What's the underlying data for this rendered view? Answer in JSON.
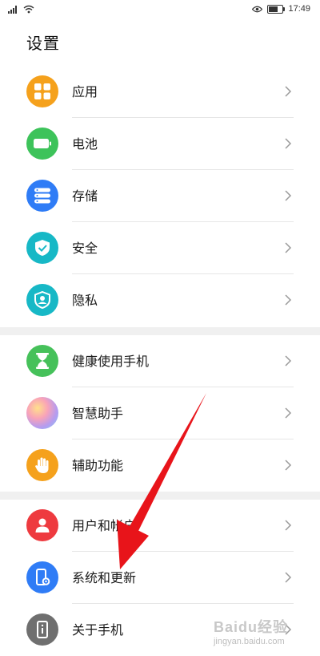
{
  "status_bar": {
    "time": "17:49"
  },
  "header": {
    "title": "设置"
  },
  "groups": [
    {
      "items": [
        {
          "label": "应用",
          "icon": "apps-grid-icon",
          "color": "#F5A11C"
        },
        {
          "label": "电池",
          "icon": "battery-icon",
          "color": "#3DC35A"
        },
        {
          "label": "存储",
          "icon": "storage-icon",
          "color": "#2F7CF6"
        },
        {
          "label": "安全",
          "icon": "shield-check-icon",
          "color": "#17B8C6"
        },
        {
          "label": "隐私",
          "icon": "privacy-shield-icon",
          "color": "#17B8C6"
        }
      ]
    },
    {
      "items": [
        {
          "label": "健康使用手机",
          "icon": "hourglass-icon",
          "color": "#46C15A"
        },
        {
          "label": "智慧助手",
          "icon": "smart-assistant-icon",
          "color": "#B69CEF"
        },
        {
          "label": "辅助功能",
          "icon": "hand-icon",
          "color": "#F5A11C"
        }
      ]
    },
    {
      "items": [
        {
          "label": "用户和帐户",
          "icon": "user-icon",
          "color": "#EE3A3F"
        },
        {
          "label": "系统和更新",
          "icon": "phone-settings-icon",
          "color": "#2F7CF6"
        },
        {
          "label": "关于手机",
          "icon": "phone-info-icon",
          "color": "#6F6F6F"
        }
      ]
    }
  ],
  "watermark": {
    "main": "Baidu经验",
    "sub": "jingyan.baidu.com"
  }
}
